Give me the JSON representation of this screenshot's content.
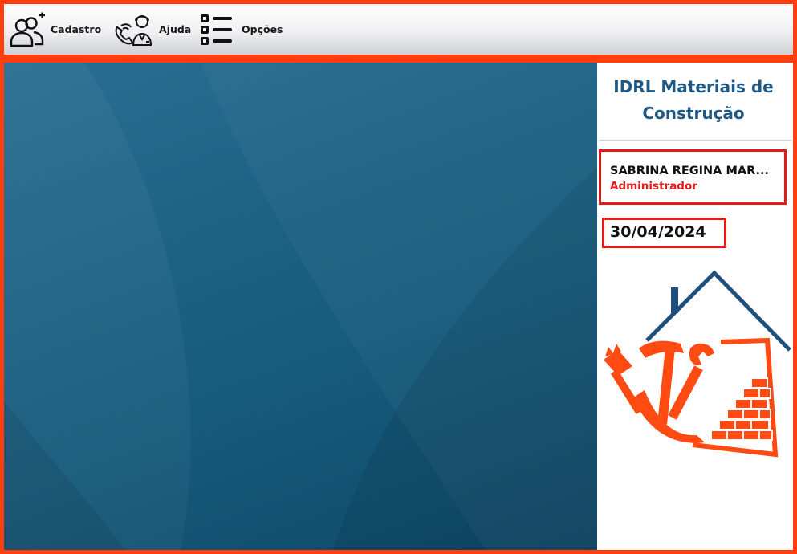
{
  "toolbar": {
    "items": [
      {
        "label": "Cadastro",
        "icon": "user-add-icon"
      },
      {
        "label": "Ajuda",
        "icon": "support-agent-icon"
      },
      {
        "label": "Opções",
        "icon": "list-options-icon"
      }
    ]
  },
  "sidebar": {
    "company_name": "IDRL Materiais de Construção",
    "user": {
      "name": "SABRINA REGINA MAR...",
      "role": "Administrador"
    },
    "date": "30/04/2024",
    "logo_icon": "construction-house-logo"
  },
  "colors": {
    "frame_border": "#ff3d0e",
    "accent_red": "#e21b1b",
    "company_blue": "#1f5a86",
    "logo_orange": "#ff4a12",
    "logo_roof": "#1f4f7c",
    "main_background": "#165a7c"
  }
}
